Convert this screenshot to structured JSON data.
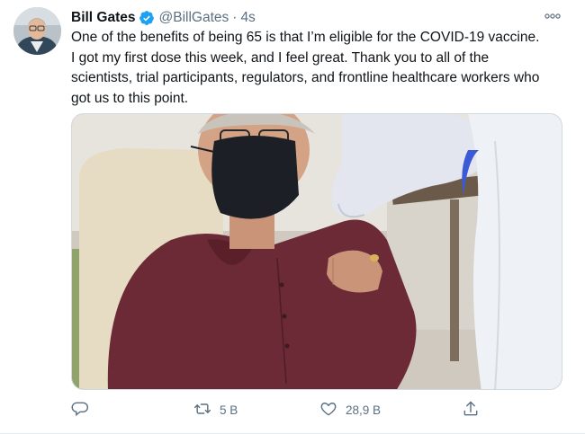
{
  "tweet": {
    "author_name": "Bill Gates",
    "handle": "@BillGates",
    "separator": "·",
    "timestamp": "4s",
    "text": "One of the benefits of being 65 is that I’m eligible for the COVID-19 vaccine.\nI got my first dose this week, and I feel great. Thank you to all of the\nscientists, trial participants, regulators, and frontline healthcare workers who\ngot us to this point.",
    "verified": true
  },
  "actions": {
    "reply_count": "",
    "retweet_count": "5 B",
    "like_count": "28,9 B"
  },
  "icons": {
    "more": "more-horizontal-icon",
    "verified": "verified-badge-icon",
    "reply": "reply-icon",
    "retweet": "retweet-icon",
    "like": "heart-icon",
    "share": "share-icon"
  },
  "colors": {
    "verified_blue": "#1da1f2",
    "muted_text": "#5b7083",
    "primary_text": "#0f1419"
  }
}
